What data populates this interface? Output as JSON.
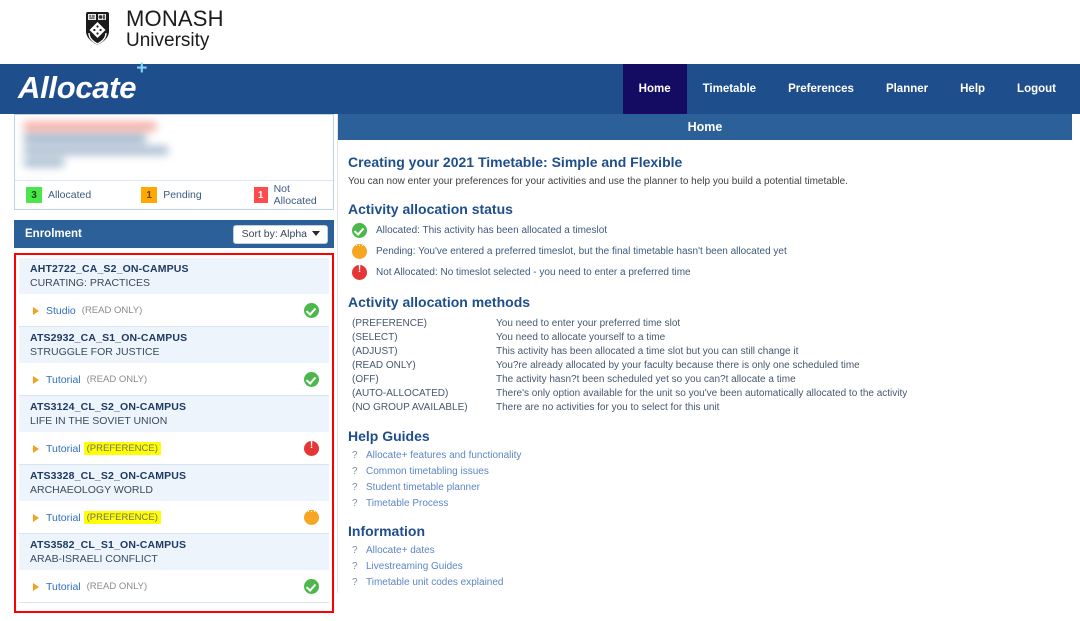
{
  "logo": {
    "line1": "MONASH",
    "line2": "University",
    "alt": "monash-crest"
  },
  "brand": {
    "name": "Allocate",
    "superscript": "+"
  },
  "nav": {
    "items": [
      {
        "label": "Home",
        "active": true
      },
      {
        "label": "Timetable",
        "active": false
      },
      {
        "label": "Preferences",
        "active": false
      },
      {
        "label": "Planner",
        "active": false
      },
      {
        "label": "Help",
        "active": false
      },
      {
        "label": "Logout",
        "active": false
      }
    ]
  },
  "sidebar": {
    "student_info_redacted": true,
    "legend": [
      {
        "count": "3",
        "label": "Allocated",
        "color": "#4ce64c"
      },
      {
        "count": "1",
        "label": "Pending",
        "color": "#ffa800"
      },
      {
        "count": "1",
        "label": "Not Allocated",
        "color": "#ff4b4b"
      }
    ],
    "enrolment_header": {
      "title": "Enrolment",
      "sort_label": "Sort by: Alpha"
    },
    "units": [
      {
        "code": "AHT2722_CA_S2_ON-CAMPUS",
        "name": "CURATING: PRACTICES",
        "activity": "Studio",
        "mode": "(READ ONLY)",
        "highlighted": false,
        "status": "allocated"
      },
      {
        "code": "ATS2932_CA_S1_ON-CAMPUS",
        "name": "STRUGGLE FOR JUSTICE",
        "activity": "Tutorial",
        "mode": "(READ ONLY)",
        "highlighted": false,
        "status": "allocated"
      },
      {
        "code": "ATS3124_CL_S2_ON-CAMPUS",
        "name": "LIFE IN THE SOVIET UNION",
        "activity": "Tutorial",
        "mode": "(PREFERENCE)",
        "highlighted": true,
        "status": "not-allocated"
      },
      {
        "code": "ATS3328_CL_S2_ON-CAMPUS",
        "name": "ARCHAEOLOGY WORLD",
        "activity": "Tutorial",
        "mode": "(PREFERENCE)",
        "highlighted": true,
        "status": "pending"
      },
      {
        "code": "ATS3582_CL_S1_ON-CAMPUS",
        "name": "ARAB-ISRAELI CONFLICT",
        "activity": "Tutorial",
        "mode": "(READ ONLY)",
        "highlighted": false,
        "status": "allocated"
      }
    ]
  },
  "main": {
    "panel_title": "Home",
    "heading": "Creating your 2021 Timetable: Simple and Flexible",
    "intro": "You can now enter your preferences for your activities and use the planner to help you build a potential timetable.",
    "status_section": {
      "title": "Activity allocation status",
      "items": [
        {
          "status": "allocated",
          "text": "Allocated: This activity has been allocated a timeslot"
        },
        {
          "status": "pending",
          "text": "Pending: You've entered a preferred timeslot, but the final timetable hasn't been allocated yet"
        },
        {
          "status": "not-allocated",
          "text": "Not Allocated: No timeslot selected - you need to enter a preferred time"
        }
      ]
    },
    "methods_section": {
      "title": "Activity allocation methods",
      "rows": [
        {
          "key": "(PREFERENCE)",
          "value": "You need to enter your preferred time slot"
        },
        {
          "key": "(SELECT)",
          "value": "You need to allocate yourself to a time"
        },
        {
          "key": "(ADJUST)",
          "value": "This activity has been allocated a time slot but you can still change it"
        },
        {
          "key": "(READ ONLY)",
          "value": "You?re already allocated by your faculty because there is only one scheduled time"
        },
        {
          "key": "(OFF)",
          "value": "The activity hasn?t been scheduled yet so you can?t allocate a time"
        },
        {
          "key": "(AUTO-ALLOCATED)",
          "value": "There's only option available for the unit so you've been automatically allocated to the activity"
        },
        {
          "key": "(NO GROUP AVAILABLE)",
          "value": "There are no activities for you to select for this unit"
        }
      ]
    },
    "help_section": {
      "title": "Help Guides",
      "bullet": "?",
      "links": [
        "Allocate+ features and functionality",
        "Common timetabling issues",
        "Student timetable planner",
        "Timetable Process"
      ]
    },
    "information_section": {
      "title": "Information",
      "bullet": "?",
      "links": [
        "Allocate+ dates",
        "Livestreaming Guides",
        "Timetable unit codes explained"
      ]
    }
  },
  "colors": {
    "brand_blue": "#1f4e8c",
    "panel_blue": "#2b6098",
    "active_nav": "#140b63",
    "link_blue": "#5d86c4",
    "highlight_yellow": "#ffff00",
    "selection_red": "#ff0000"
  }
}
